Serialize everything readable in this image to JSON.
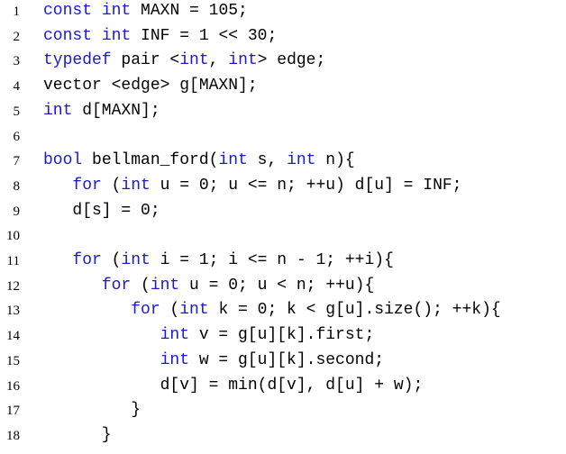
{
  "colors": {
    "keyword": "#1a1acc",
    "text": "#000000",
    "background": "#ffffff"
  },
  "lines": [
    {
      "number": "1",
      "tokens": [
        {
          "t": "const",
          "kw": true
        },
        {
          "t": " "
        },
        {
          "t": "int",
          "kw": true
        },
        {
          "t": " MAXN = 105;"
        }
      ]
    },
    {
      "number": "2",
      "tokens": [
        {
          "t": "const",
          "kw": true
        },
        {
          "t": " "
        },
        {
          "t": "int",
          "kw": true
        },
        {
          "t": " INF = 1 << 30;"
        }
      ]
    },
    {
      "number": "3",
      "tokens": [
        {
          "t": "typedef",
          "kw": true
        },
        {
          "t": " pair <"
        },
        {
          "t": "int",
          "kw": true
        },
        {
          "t": ", "
        },
        {
          "t": "int",
          "kw": true
        },
        {
          "t": "> edge;"
        }
      ]
    },
    {
      "number": "4",
      "tokens": [
        {
          "t": "vector <edge> g[MAXN];"
        }
      ]
    },
    {
      "number": "5",
      "tokens": [
        {
          "t": "int",
          "kw": true
        },
        {
          "t": " d[MAXN];"
        }
      ]
    },
    {
      "number": "6",
      "tokens": []
    },
    {
      "number": "7",
      "tokens": [
        {
          "t": "bool",
          "kw": true
        },
        {
          "t": " bellman_ford("
        },
        {
          "t": "int",
          "kw": true
        },
        {
          "t": " s, "
        },
        {
          "t": "int",
          "kw": true
        },
        {
          "t": " n){"
        }
      ]
    },
    {
      "number": "8",
      "tokens": [
        {
          "t": "   "
        },
        {
          "t": "for",
          "kw": true
        },
        {
          "t": " ("
        },
        {
          "t": "int",
          "kw": true
        },
        {
          "t": " u = 0; u <= n; ++u) d[u] = INF;"
        }
      ]
    },
    {
      "number": "9",
      "tokens": [
        {
          "t": "   d[s] = 0;"
        }
      ]
    },
    {
      "number": "10",
      "tokens": []
    },
    {
      "number": "11",
      "tokens": [
        {
          "t": "   "
        },
        {
          "t": "for",
          "kw": true
        },
        {
          "t": " ("
        },
        {
          "t": "int",
          "kw": true
        },
        {
          "t": " i = 1; i <= n - 1; ++i){"
        }
      ]
    },
    {
      "number": "12",
      "tokens": [
        {
          "t": "      "
        },
        {
          "t": "for",
          "kw": true
        },
        {
          "t": " ("
        },
        {
          "t": "int",
          "kw": true
        },
        {
          "t": " u = 0; u < n; ++u){"
        }
      ]
    },
    {
      "number": "13",
      "tokens": [
        {
          "t": "         "
        },
        {
          "t": "for",
          "kw": true
        },
        {
          "t": " ("
        },
        {
          "t": "int",
          "kw": true
        },
        {
          "t": " k = 0; k < g[u].size(); ++k){"
        }
      ]
    },
    {
      "number": "14",
      "tokens": [
        {
          "t": "            "
        },
        {
          "t": "int",
          "kw": true
        },
        {
          "t": " v = g[u][k].first;"
        }
      ]
    },
    {
      "number": "15",
      "tokens": [
        {
          "t": "            "
        },
        {
          "t": "int",
          "kw": true
        },
        {
          "t": " w = g[u][k].second;"
        }
      ]
    },
    {
      "number": "16",
      "tokens": [
        {
          "t": "            d[v] = min(d[v], d[u] + w);"
        }
      ]
    },
    {
      "number": "17",
      "tokens": [
        {
          "t": "         }"
        }
      ]
    },
    {
      "number": "18",
      "tokens": [
        {
          "t": "      }"
        }
      ]
    }
  ]
}
